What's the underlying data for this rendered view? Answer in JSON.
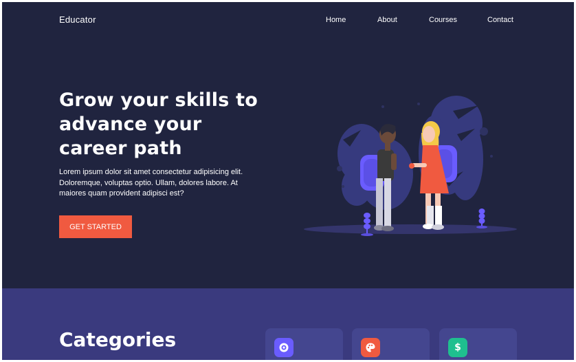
{
  "header": {
    "brand": "Educator",
    "nav": [
      {
        "label": "Home"
      },
      {
        "label": "About"
      },
      {
        "label": "Courses"
      },
      {
        "label": "Contact"
      }
    ]
  },
  "hero": {
    "title_lines": [
      "Grow your skills to",
      "advance your",
      "career path"
    ],
    "description_lines": [
      "Lorem ipsum dolor sit amet consectetur adipisicing elit.",
      "Doloremque, voluptas optio. Ullam, dolores labore. At",
      "maiores quam provident adipisci est?"
    ],
    "cta_label": "GET STARTED"
  },
  "categories": {
    "title": "Categories",
    "cards": [
      {
        "icon": "coin-icon",
        "color": "#6a5cff"
      },
      {
        "icon": "palette-icon",
        "color": "#f05a40"
      },
      {
        "icon": "dollar-icon",
        "color": "#1fbf8f",
        "symbol": "$"
      }
    ]
  },
  "colors": {
    "background": "#20243f",
    "categories_background": "#3a3a7e",
    "card": "#44468f",
    "accent": "#f05a40",
    "illustration": "#6a5cff"
  }
}
